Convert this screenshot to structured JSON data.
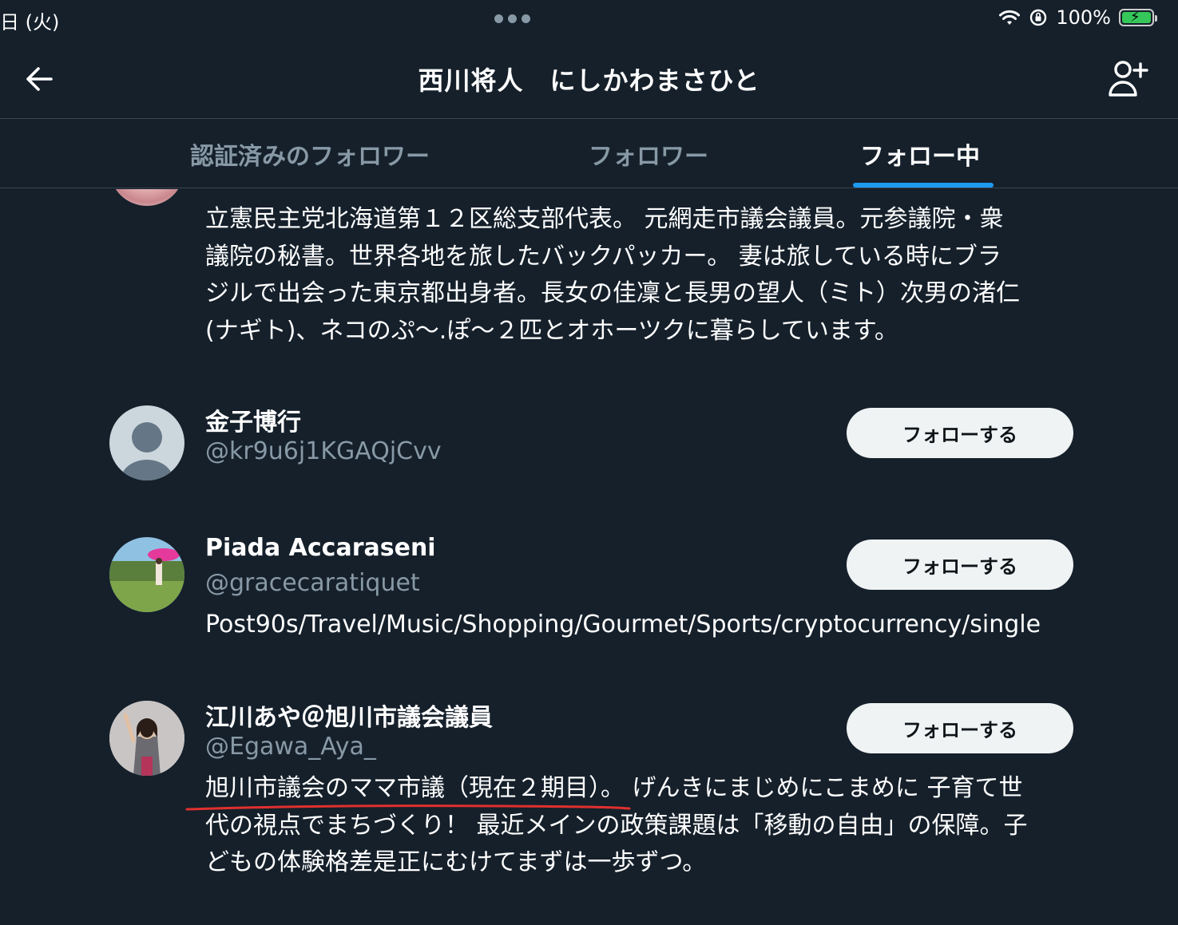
{
  "status_bar": {
    "time": "日 (火)",
    "battery_percent": "100%"
  },
  "header": {
    "title": "西川将人　にしかわまさひと"
  },
  "tabs": [
    {
      "label": "認証済みのフォロワー",
      "active": false
    },
    {
      "label": "フォロワー",
      "active": false
    },
    {
      "label": "フォロー中",
      "active": true
    }
  ],
  "list": {
    "partial_user_bio": [
      "立憲民主党北海道第１２区総支部代表。 元網走市議会議員。元参議院・衆",
      "議院の秘書。世界各地を旅したバックパッカー。 妻は旅している時にブラ",
      "ジルで出会った東京都出身者。長女の佳凜と長男の望人（ミト）次男の渚仁",
      "(ナギト)、ネコのぷ〜.ぽ〜２匹とオホーツクに暮らしています。"
    ],
    "users": [
      {
        "name": "金子博行",
        "handle": "@kr9u6j1KGAQjCvv",
        "follow_label": "フォローする",
        "bio": []
      },
      {
        "name": "Piada Accaraseni",
        "handle": "@gracecaratiquet",
        "follow_label": "フォローする",
        "bio": [
          "Post90s/Travel/Music/Shopping/Gourmet/Sports/cryptocurrency/single"
        ]
      },
      {
        "name": "江川あや＠旭川市議会議員",
        "handle": "@Egawa_Aya_",
        "follow_label": "フォローする",
        "bio": [
          "旭川市議会のママ市議（現在２期目）。 げんきにまじめにこまめに 子育て世",
          "代の視点でまちづくり！ 最近メインの政策課題は「移動の自由」の保障。子",
          "どもの体験格差是正にむけてまずは一歩ずつ。"
        ]
      }
    ]
  },
  "colors": {
    "background": "#15202b",
    "accent": "#1d9bf0",
    "secondary_text": "#8899a6",
    "annotation_red": "#e0302e"
  }
}
